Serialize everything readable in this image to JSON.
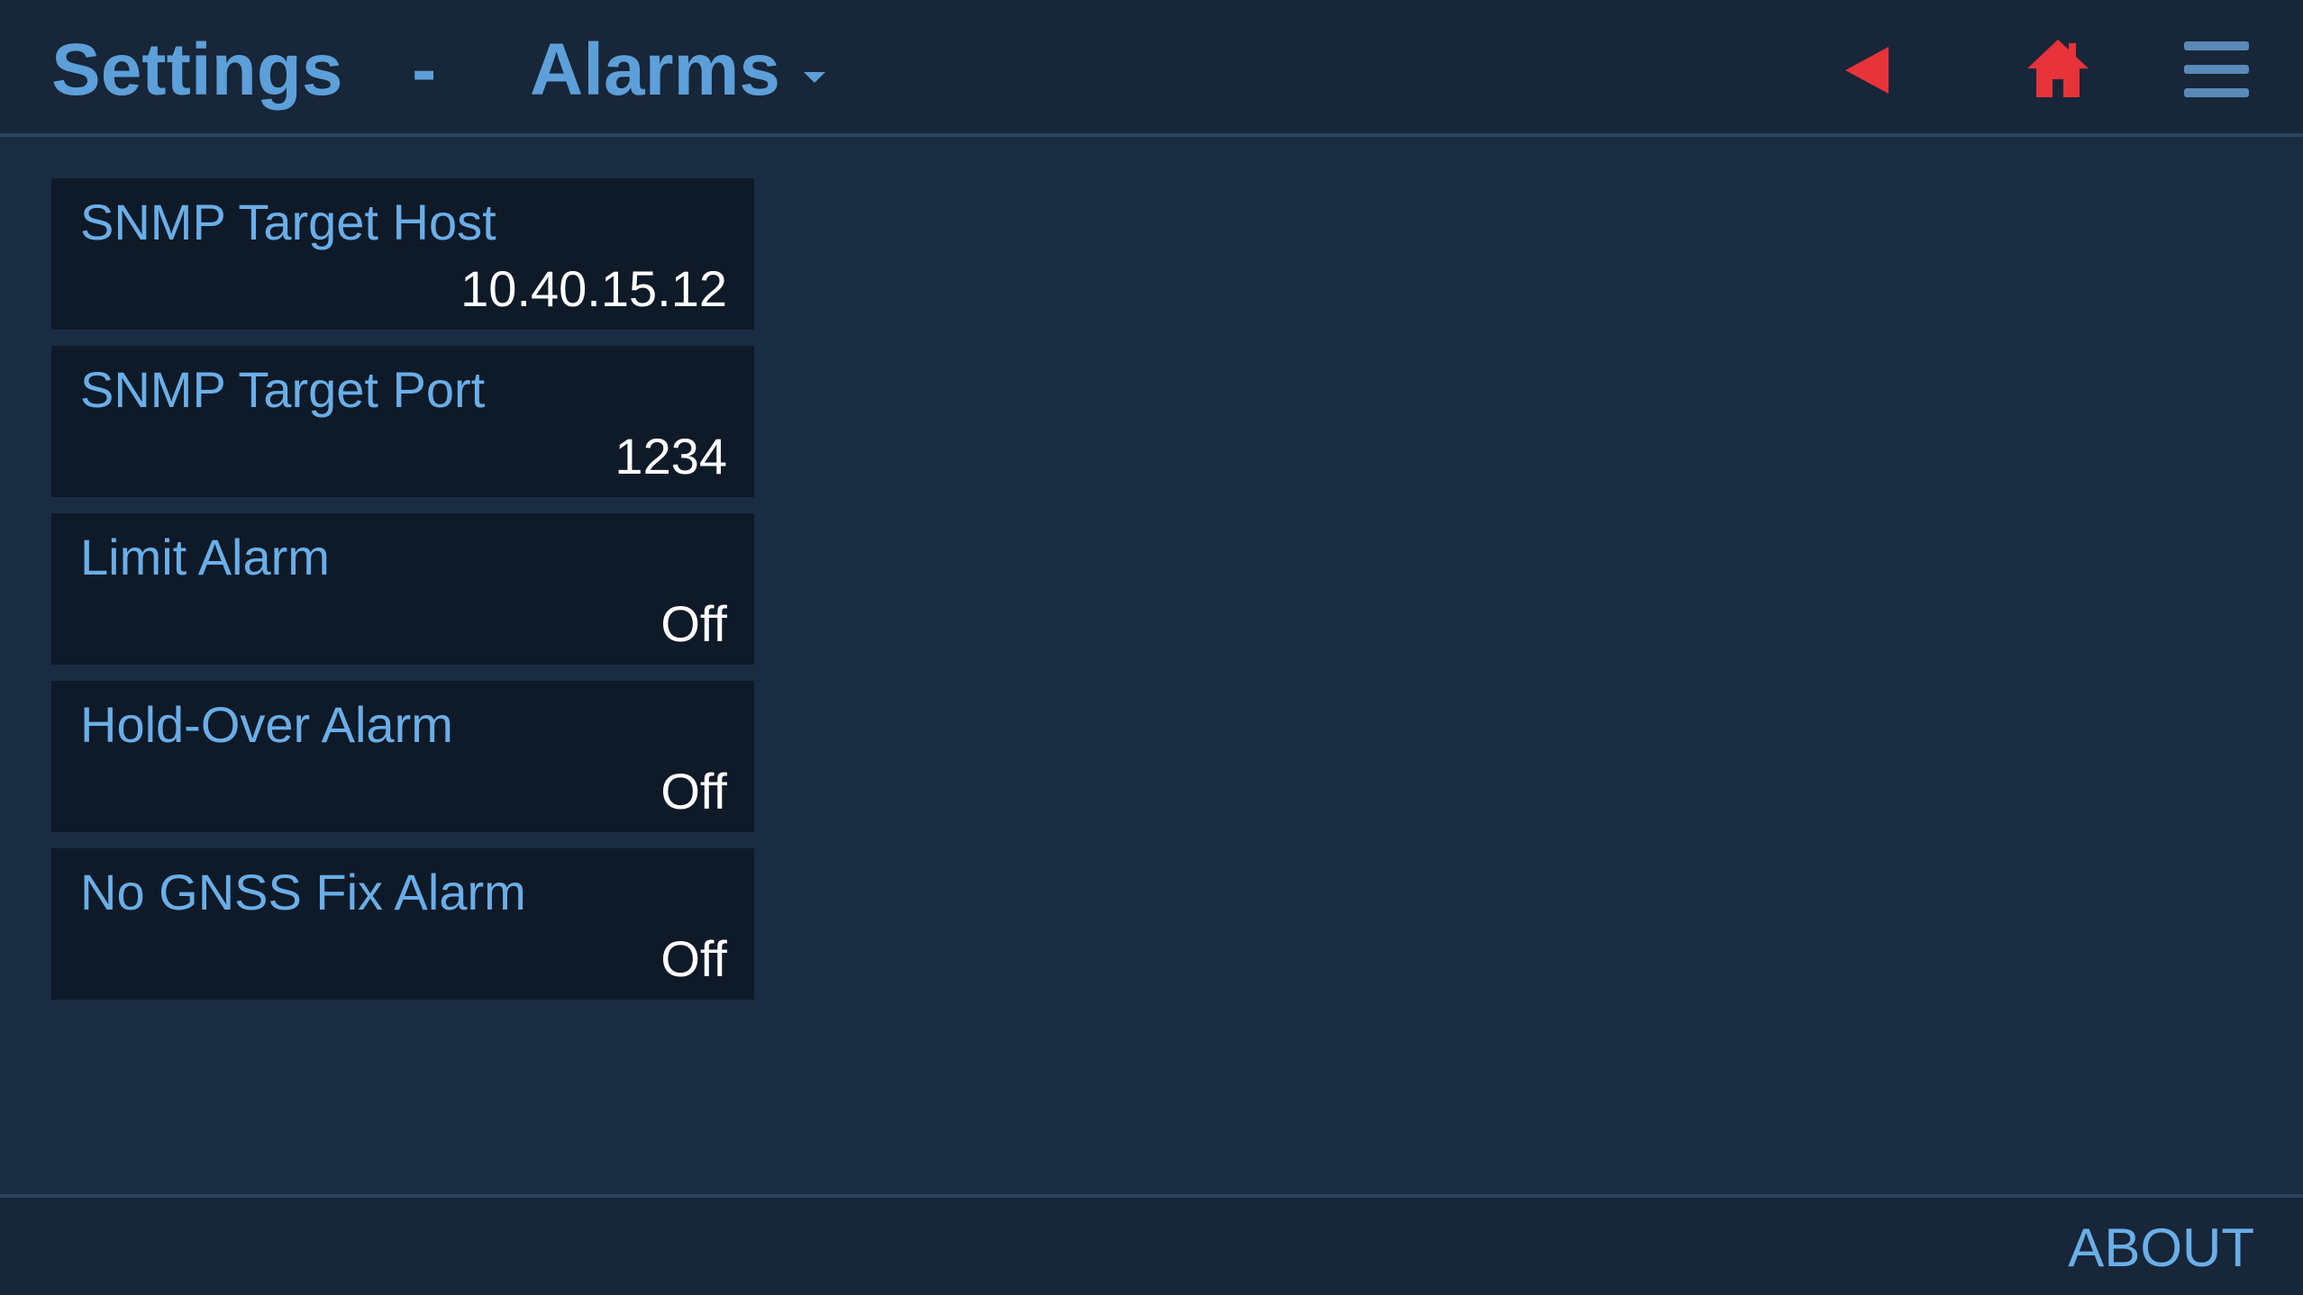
{
  "header": {
    "title": "Settings",
    "separator": "-",
    "section": "Alarms",
    "dropdown_icon": "caret-down-icon",
    "back_icon": "back-arrow-icon",
    "home_icon": "home-icon",
    "menu_icon": "hamburger-menu-icon"
  },
  "items": [
    {
      "label": "SNMP Target Host",
      "value": "10.40.15.12"
    },
    {
      "label": "SNMP Target Port",
      "value": "1234"
    },
    {
      "label": "Limit Alarm",
      "value": "Off"
    },
    {
      "label": "Hold-Over Alarm",
      "value": "Off"
    },
    {
      "label": "No GNSS Fix Alarm",
      "value": "Off"
    }
  ],
  "footer": {
    "about_label": "ABOUT"
  },
  "colors": {
    "background": "#1a2c42",
    "header_background": "#172638",
    "card_background": "#0e1a28",
    "accent_blue": "#5d9fd8",
    "alert_red": "#e8333a",
    "value_white": "#ffffff"
  }
}
